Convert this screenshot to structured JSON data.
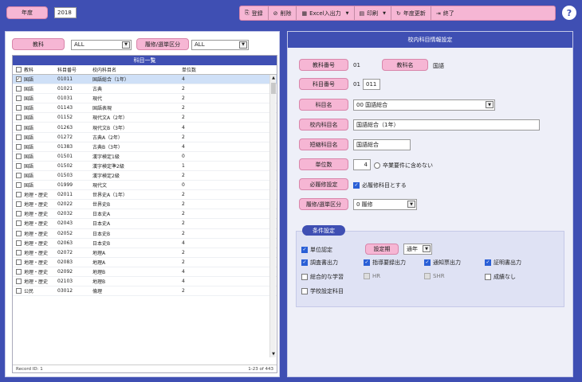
{
  "header": {
    "year_label": "年度",
    "year_value": "2018",
    "toolbar": [
      {
        "icon": "⎘",
        "label": "登録",
        "dropdown": false,
        "name": "register"
      },
      {
        "icon": "⊘",
        "label": "削除",
        "dropdown": false,
        "name": "delete"
      },
      {
        "icon": "▦",
        "label": "Excel入出力",
        "dropdown": true,
        "name": "excel"
      },
      {
        "icon": "▤",
        "label": "印刷",
        "dropdown": true,
        "name": "print"
      },
      {
        "icon": "↻",
        "label": "年度更新",
        "dropdown": false,
        "name": "year-update"
      },
      {
        "icon": "⇥",
        "label": "終了",
        "dropdown": false,
        "name": "exit"
      }
    ],
    "help": "?"
  },
  "filter": {
    "subject_label": "教科",
    "subject_value": "ALL",
    "required_label": "履修/選単区分",
    "required_value": "ALL"
  },
  "list": {
    "title": "科目一覧",
    "columns": [
      "教科",
      "科目番号",
      "校内科目名",
      "単位数"
    ],
    "rows": [
      {
        "checked": true,
        "subject": "国語",
        "code": "01011",
        "name": "国語総合（1年）",
        "units": "4"
      },
      {
        "checked": false,
        "subject": "国語",
        "code": "01021",
        "name": "古典",
        "units": "2"
      },
      {
        "checked": false,
        "subject": "国語",
        "code": "01031",
        "name": "現代",
        "units": "2"
      },
      {
        "checked": false,
        "subject": "国語",
        "code": "01143",
        "name": "国語表現",
        "units": "2"
      },
      {
        "checked": false,
        "subject": "国語",
        "code": "01152",
        "name": "現代文A（2年）",
        "units": "2"
      },
      {
        "checked": false,
        "subject": "国語",
        "code": "01263",
        "name": "現代文B（3年）",
        "units": "4"
      },
      {
        "checked": false,
        "subject": "国語",
        "code": "01272",
        "name": "古典A（2年）",
        "units": "2"
      },
      {
        "checked": false,
        "subject": "国語",
        "code": "01383",
        "name": "古典B（3年）",
        "units": "4"
      },
      {
        "checked": false,
        "subject": "国語",
        "code": "01501",
        "name": "漢字検定1級",
        "units": "0"
      },
      {
        "checked": false,
        "subject": "国語",
        "code": "01502",
        "name": "漢字検定準2級",
        "units": "1"
      },
      {
        "checked": false,
        "subject": "国語",
        "code": "01503",
        "name": "漢字検定2級",
        "units": "2"
      },
      {
        "checked": false,
        "subject": "国語",
        "code": "01999",
        "name": "現代文",
        "units": "0"
      },
      {
        "checked": false,
        "subject": "地理・歴史",
        "code": "02011",
        "name": "世界史A（1年）",
        "units": "2"
      },
      {
        "checked": false,
        "subject": "地理・歴史",
        "code": "02022",
        "name": "世界史B",
        "units": "2"
      },
      {
        "checked": false,
        "subject": "地理・歴史",
        "code": "02032",
        "name": "日本史A",
        "units": "2"
      },
      {
        "checked": false,
        "subject": "地理・歴史",
        "code": "02043",
        "name": "日本史A",
        "units": "2"
      },
      {
        "checked": false,
        "subject": "地理・歴史",
        "code": "02052",
        "name": "日本史B",
        "units": "2"
      },
      {
        "checked": false,
        "subject": "地理・歴史",
        "code": "02063",
        "name": "日本史B",
        "units": "4"
      },
      {
        "checked": false,
        "subject": "地理・歴史",
        "code": "02072",
        "name": "地理A",
        "units": "2"
      },
      {
        "checked": false,
        "subject": "地理・歴史",
        "code": "02083",
        "name": "地理A",
        "units": "2"
      },
      {
        "checked": false,
        "subject": "地理・歴史",
        "code": "02092",
        "name": "地理B",
        "units": "4"
      },
      {
        "checked": false,
        "subject": "地理・歴史",
        "code": "02103",
        "name": "地理B",
        "units": "4"
      },
      {
        "checked": false,
        "subject": "公民",
        "code": "03012",
        "name": "倫理",
        "units": "2"
      }
    ],
    "footer_left": "Record ID: 1",
    "footer_right": "1-23 of 443"
  },
  "detail": {
    "title": "校内科目情報設定",
    "subject_no_label": "教科番号",
    "subject_no_value": "01",
    "subject_name_label": "教科名",
    "subject_name_value": "国語",
    "course_no_label": "科目番号",
    "course_no_prefix": "01",
    "course_no_value": "011",
    "course_name_label": "科目名",
    "course_name_value": "00 国語総合",
    "school_name_label": "校内科目名",
    "school_name_value": "国語総合（1年）",
    "short_name_label": "短縮科目名",
    "short_name_value": "国語総合",
    "units_label": "単位数",
    "units_value": "4",
    "units_check_label": "卒業要件に含めない",
    "mandatory_label": "必履修設定",
    "mandatory_check_label": "必履修科目とする",
    "required_label": "履修/選単区分",
    "required_value": "0 履修",
    "conditions": {
      "label": "条件設定",
      "grade_cert_label": "単位認定",
      "period_label": "設定期",
      "period_value": "通年",
      "items": [
        {
          "label": "調査書出力",
          "checked": true,
          "disabled": false
        },
        {
          "label": "指導要録出力",
          "checked": true,
          "disabled": false
        },
        {
          "label": "通知票出力",
          "checked": true,
          "disabled": false
        },
        {
          "label": "証明書出力",
          "checked": true,
          "disabled": false
        },
        {
          "label": "総合的な学習",
          "checked": false,
          "disabled": false
        },
        {
          "label": "HR",
          "checked": false,
          "disabled": true
        },
        {
          "label": "SHR",
          "checked": false,
          "disabled": true
        },
        {
          "label": "成績なし",
          "checked": false,
          "disabled": false
        },
        {
          "label": "学校設定科目",
          "checked": false,
          "disabled": false
        }
      ]
    }
  }
}
